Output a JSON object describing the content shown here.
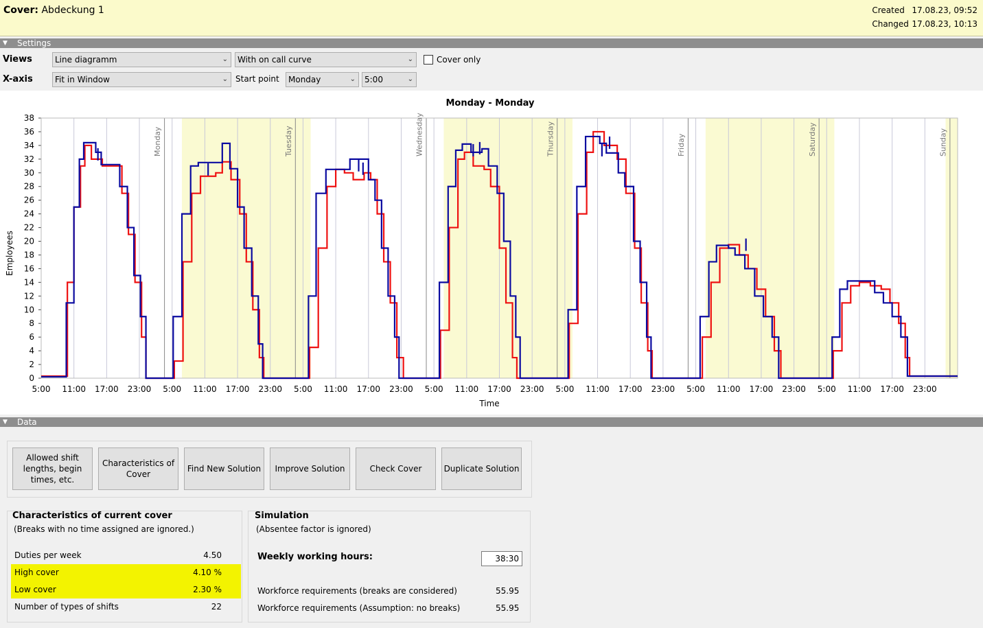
{
  "header": {
    "label": "Cover:",
    "name": "Abdeckung 1",
    "created_label": "Created",
    "created_value": "17.08.23, 09:52",
    "changed_label": "Changed",
    "changed_value": "17.08.23, 10:13"
  },
  "settings": {
    "title": "Settings",
    "views_label": "Views",
    "views_value": "Line diagramm",
    "curve_value": "With on call curve",
    "cover_only_label": "Cover only",
    "xaxis_label": "X-axis",
    "xaxis_value": "Fit in Window",
    "start_point_label": "Start point",
    "start_day": "Monday",
    "start_time": "5:00"
  },
  "chart_data": {
    "type": "line",
    "title": "Monday - Monday",
    "xlabel": "Time",
    "ylabel": "Employees",
    "ylim": [
      0,
      38
    ],
    "y_ticks": [
      0,
      2,
      4,
      6,
      8,
      10,
      12,
      14,
      16,
      18,
      20,
      22,
      24,
      26,
      28,
      30,
      32,
      34,
      36,
      38
    ],
    "x_tick_labels": [
      "5:00",
      "11:00",
      "17:00",
      "23:00",
      "5:00",
      "11:00",
      "17:00",
      "23:00",
      "5:00",
      "11:00",
      "17:00",
      "23:00",
      "5:00",
      "11:00",
      "17:00",
      "23:00",
      "5:00",
      "11:00",
      "17:00",
      "23:00",
      "5:00",
      "11:00",
      "17:00",
      "23:00",
      "5:00",
      "11:00",
      "17:00",
      "23:00"
    ],
    "day_labels": [
      "Monday",
      "Tuesday",
      "Wednesday",
      "Thursday",
      "Friday",
      "Saturday",
      "Sunday"
    ],
    "colors": {
      "requirement": "#ee1111",
      "cover": "#0a0aa0",
      "weekday_band": "#fafad2"
    },
    "grid": true,
    "series": [
      {
        "name": "",
        "points": [
          [
            0,
            0.3
          ],
          [
            2,
            0.3
          ],
          [
            2.4,
            14
          ],
          [
            3,
            25
          ],
          [
            3.6,
            31
          ],
          [
            4,
            34
          ],
          [
            4.6,
            32
          ],
          [
            5.6,
            31
          ],
          [
            6.8,
            31
          ],
          [
            7.4,
            27
          ],
          [
            8,
            21
          ],
          [
            8.6,
            14
          ],
          [
            9.2,
            6
          ],
          [
            9.6,
            0
          ],
          [
            11.6,
            0
          ],
          [
            12.2,
            2.5
          ],
          [
            13,
            17
          ],
          [
            13.8,
            27
          ],
          [
            14.6,
            29.5
          ],
          [
            16,
            30
          ],
          [
            16.6,
            31.6
          ],
          [
            17.4,
            29
          ],
          [
            18.2,
            24
          ],
          [
            18.8,
            17
          ],
          [
            19.4,
            10
          ],
          [
            20,
            3
          ],
          [
            20.4,
            0
          ],
          [
            24,
            0
          ],
          [
            24.6,
            4.5
          ],
          [
            25.4,
            19
          ],
          [
            26.2,
            28
          ],
          [
            27,
            30.5
          ],
          [
            27.8,
            30
          ],
          [
            28.6,
            29
          ],
          [
            29.6,
            30
          ],
          [
            30.2,
            29
          ],
          [
            30.8,
            24
          ],
          [
            31.4,
            17
          ],
          [
            32,
            11
          ],
          [
            32.6,
            3
          ],
          [
            33.2,
            0
          ],
          [
            36,
            0
          ],
          [
            36.6,
            7
          ],
          [
            37.4,
            22
          ],
          [
            38.2,
            32
          ],
          [
            38.8,
            33
          ],
          [
            39.6,
            31
          ],
          [
            40.6,
            30.5
          ],
          [
            41.2,
            28
          ],
          [
            42,
            19
          ],
          [
            42.6,
            11
          ],
          [
            43.2,
            3
          ],
          [
            43.6,
            0
          ],
          [
            48,
            0
          ],
          [
            48.4,
            8
          ],
          [
            49.2,
            24
          ],
          [
            50,
            33
          ],
          [
            50.6,
            36
          ],
          [
            51.6,
            34
          ],
          [
            52.8,
            32
          ],
          [
            53.6,
            27
          ],
          [
            54.4,
            19
          ],
          [
            55,
            11
          ],
          [
            55.6,
            4
          ],
          [
            56,
            0
          ],
          [
            60,
            0
          ],
          [
            60.6,
            6
          ],
          [
            61.4,
            14
          ],
          [
            62.2,
            19
          ],
          [
            63,
            19.5
          ],
          [
            64,
            18
          ],
          [
            64.8,
            16
          ],
          [
            65.6,
            13
          ],
          [
            66.4,
            9
          ],
          [
            67.2,
            4
          ],
          [
            67.8,
            0
          ],
          [
            72,
            0
          ],
          [
            72.6,
            4
          ],
          [
            73.4,
            11
          ],
          [
            74.2,
            13.5
          ],
          [
            75,
            14
          ],
          [
            76,
            13.5
          ],
          [
            77,
            13
          ],
          [
            77.8,
            11
          ],
          [
            78.6,
            8
          ],
          [
            79.2,
            3
          ],
          [
            79.6,
            0.3
          ],
          [
            84,
            0.3
          ]
        ]
      },
      {
        "name": "",
        "points": [
          [
            0,
            0.2
          ],
          [
            2,
            0.2
          ],
          [
            2.3,
            11
          ],
          [
            3,
            25
          ],
          [
            3.5,
            32
          ],
          [
            3.9,
            34.4
          ],
          [
            4.4,
            34.4
          ],
          [
            5,
            33
          ],
          [
            5.5,
            31.2
          ],
          [
            6.6,
            31.2
          ],
          [
            7.2,
            28
          ],
          [
            7.9,
            22
          ],
          [
            8.5,
            15
          ],
          [
            9.1,
            9
          ],
          [
            9.6,
            0
          ],
          [
            11.6,
            0
          ],
          [
            12.1,
            9
          ],
          [
            12.9,
            24
          ],
          [
            13.7,
            31
          ],
          [
            14.4,
            31.5
          ],
          [
            16.6,
            34.3
          ],
          [
            17.3,
            30.6
          ],
          [
            18,
            25
          ],
          [
            18.6,
            19
          ],
          [
            19.3,
            12
          ],
          [
            19.9,
            5
          ],
          [
            20.3,
            0
          ],
          [
            24,
            0
          ],
          [
            24.5,
            12
          ],
          [
            25.2,
            27
          ],
          [
            26.1,
            30.5
          ],
          [
            27.5,
            30.5
          ],
          [
            28.3,
            32
          ],
          [
            29.3,
            32
          ],
          [
            30,
            29
          ],
          [
            30.6,
            26
          ],
          [
            31.2,
            19
          ],
          [
            31.8,
            12
          ],
          [
            32.4,
            6
          ],
          [
            32.8,
            0
          ],
          [
            36,
            0
          ],
          [
            36.5,
            14
          ],
          [
            37.3,
            28
          ],
          [
            38,
            33.3
          ],
          [
            38.6,
            34.2
          ],
          [
            39.4,
            33
          ],
          [
            40.4,
            33.5
          ],
          [
            41,
            31
          ],
          [
            41.8,
            27
          ],
          [
            42.4,
            20
          ],
          [
            43,
            12
          ],
          [
            43.5,
            6
          ],
          [
            43.9,
            0
          ],
          [
            48,
            0
          ],
          [
            48.3,
            10
          ],
          [
            49.1,
            28
          ],
          [
            49.9,
            35.3
          ],
          [
            50.6,
            35.3
          ],
          [
            51.2,
            34.3
          ],
          [
            51.8,
            32.9
          ],
          [
            52.3,
            32.9
          ],
          [
            52.9,
            30
          ],
          [
            53.5,
            28
          ],
          [
            54.3,
            20
          ],
          [
            54.9,
            14
          ],
          [
            55.5,
            6
          ],
          [
            55.9,
            0
          ],
          [
            60,
            0
          ],
          [
            60.4,
            9
          ],
          [
            61.2,
            17
          ],
          [
            61.9,
            19.4
          ],
          [
            62.5,
            19.4
          ],
          [
            63,
            19
          ],
          [
            63.6,
            18
          ],
          [
            64.5,
            16
          ],
          [
            65.4,
            12
          ],
          [
            66.2,
            9
          ],
          [
            67,
            6
          ],
          [
            67.6,
            0
          ],
          [
            72,
            0
          ],
          [
            72.5,
            6
          ],
          [
            73.2,
            13
          ],
          [
            73.9,
            14.2
          ],
          [
            75.6,
            14.2
          ],
          [
            76.4,
            12.5
          ],
          [
            77.2,
            11
          ],
          [
            78,
            9
          ],
          [
            78.8,
            6
          ],
          [
            79.4,
            0.3
          ],
          [
            84,
            0.3
          ]
        ],
        "spikes": [
          [
            5.2,
            33.6
          ],
          [
            15.3,
            31.4
          ],
          [
            29.1,
            32
          ],
          [
            29.5,
            31.5
          ],
          [
            39.6,
            34.2
          ],
          [
            40.2,
            34.5
          ],
          [
            51.4,
            34.2
          ],
          [
            52.1,
            35.3
          ],
          [
            64.6,
            20.4
          ]
        ]
      }
    ]
  },
  "data_section": {
    "title": "Data",
    "buttons": [
      "Allowed shift lengths, begin times, etc.",
      "Characteristics of Cover",
      "Find New Solution",
      "Improve Solution",
      "Check Cover",
      "Duplicate Solution"
    ],
    "characteristics": {
      "title": "Characteristics of current cover",
      "note": "(Breaks with no time assigned are ignored.)",
      "rows": [
        {
          "name": "Duties per week",
          "value": "4.50",
          "highlight": false
        },
        {
          "name": "High cover",
          "value": "4.10 %",
          "highlight": true
        },
        {
          "name": "Low cover",
          "value": "2.30 %",
          "highlight": true
        },
        {
          "name": "Number of types of shifts",
          "value": "22",
          "highlight": false
        }
      ]
    },
    "simulation": {
      "title": "Simulation",
      "note": "(Absentee factor is ignored)",
      "weekly_hours_label": "Weekly working hours:",
      "weekly_hours_value": "38:30",
      "req_breaks_label": "Workforce requirements (breaks are considered)",
      "req_breaks_value": "55.95",
      "req_nobreaks_label": "Workforce requirements (Assumption: no breaks)",
      "req_nobreaks_value": "55.95"
    }
  }
}
